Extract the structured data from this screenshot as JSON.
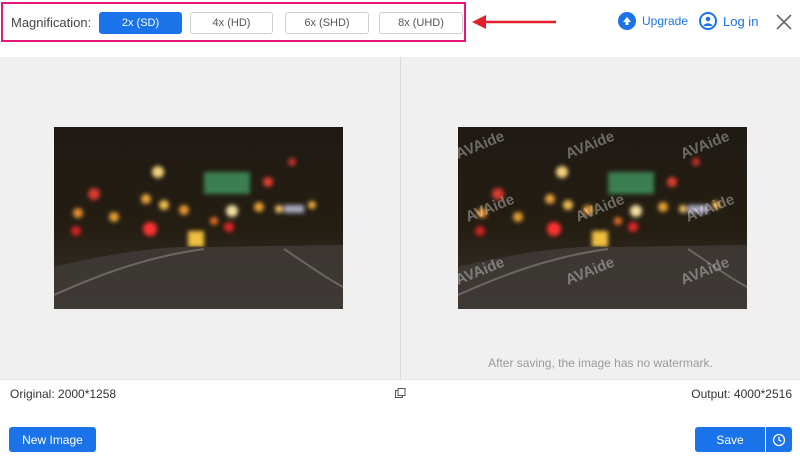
{
  "magnification": {
    "label": "Magnification:",
    "options": [
      "2x (SD)",
      "4x (HD)",
      "6x (SHD)",
      "8x (UHD)"
    ],
    "selected": "2x (SD)"
  },
  "header": {
    "upgrade_label": "Upgrade",
    "login_label": "Log in"
  },
  "preview": {
    "watermark_text": "AVAide",
    "watermark_note": "After saving, the image has no watermark."
  },
  "info": {
    "original": "Original: 2000*1258",
    "output": "Output: 4000*2516"
  },
  "actions": {
    "new_image_label": "New Image",
    "save_label": "Save"
  },
  "colors": {
    "accent": "#1a73e8",
    "highlight_box": "#e4177e",
    "arrow": "#e0202a"
  },
  "icons": [
    "upgrade-icon",
    "user-icon",
    "close-icon",
    "compare-icon",
    "history-icon"
  ]
}
